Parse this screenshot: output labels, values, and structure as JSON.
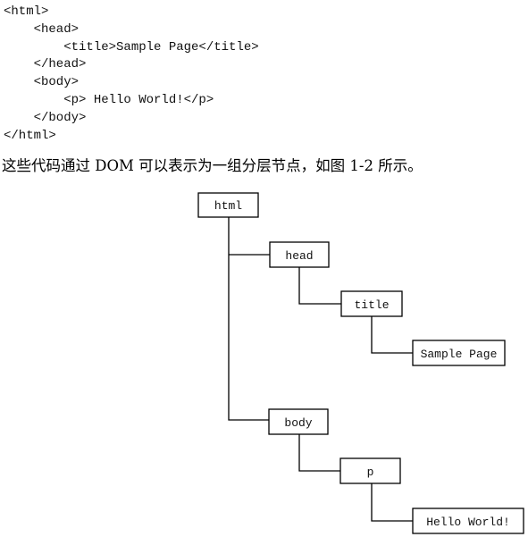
{
  "code_lines": [
    "<html>",
    "    <head>",
    "        <title>Sample Page</title>",
    "    </head>",
    "    <body>",
    "        <p> Hello World!</p>",
    "    </body>",
    "</html>"
  ],
  "caption": "这些代码通过 DOM 可以表示为一组分层节点，如图 1-2 所示。",
  "tree": {
    "html": "html",
    "head": "head",
    "title": "title",
    "title_text": "Sample Page",
    "body": "body",
    "p": "p",
    "p_text": "Hello World!"
  }
}
